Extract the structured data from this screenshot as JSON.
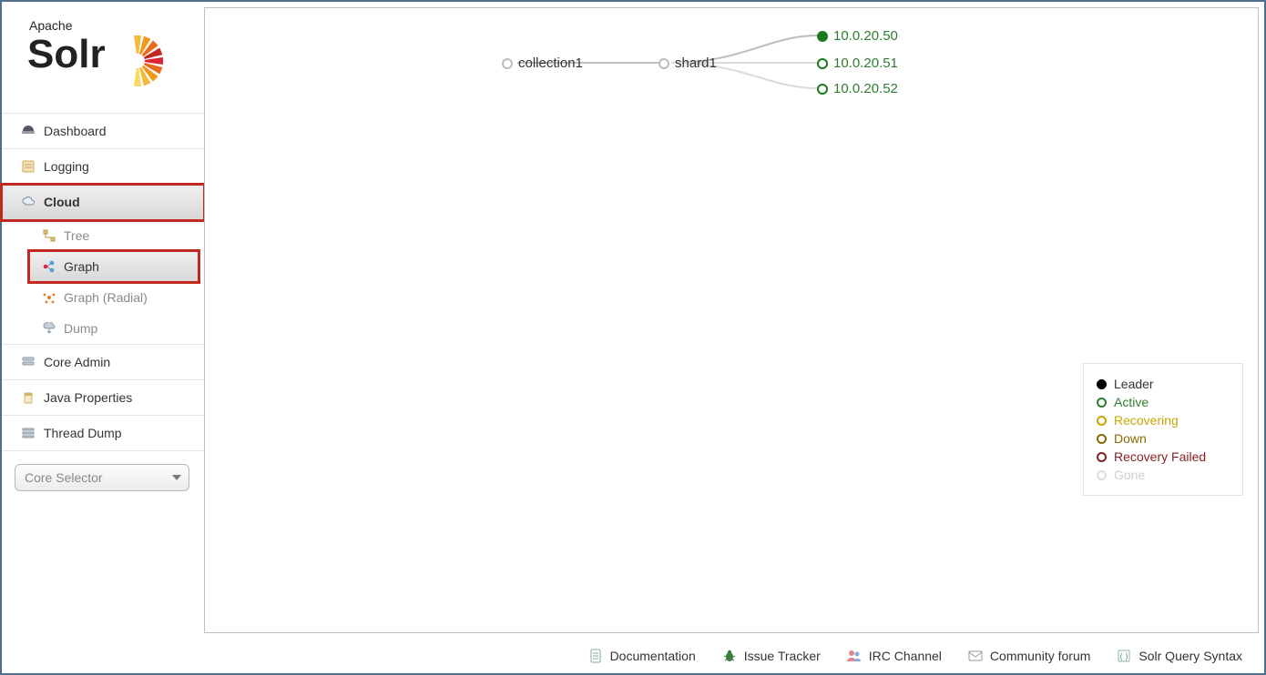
{
  "brand": {
    "apache": "Apache",
    "solr": "Solr"
  },
  "sidebar": {
    "items": [
      {
        "label": "Dashboard"
      },
      {
        "label": "Logging"
      },
      {
        "label": "Cloud"
      },
      {
        "label": "Core Admin"
      },
      {
        "label": "Java Properties"
      },
      {
        "label": "Thread Dump"
      }
    ],
    "cloud_sub": [
      {
        "label": "Tree"
      },
      {
        "label": "Graph"
      },
      {
        "label": "Graph (Radial)"
      },
      {
        "label": "Dump"
      }
    ],
    "core_selector_placeholder": "Core Selector"
  },
  "graph": {
    "collection": "collection1",
    "shard": "shard1",
    "replicas": [
      {
        "ip": "10.0.20.50",
        "role": "leader"
      },
      {
        "ip": "10.0.20.51",
        "role": "active"
      },
      {
        "ip": "10.0.20.52",
        "role": "active"
      }
    ]
  },
  "legend": {
    "leader": "Leader",
    "active": "Active",
    "recovering": "Recovering",
    "down": "Down",
    "recovery_failed": "Recovery Failed",
    "gone": "Gone"
  },
  "footer": {
    "documentation": "Documentation",
    "issue_tracker": "Issue Tracker",
    "irc_channel": "IRC Channel",
    "community_forum": "Community forum",
    "solr_query_syntax": "Solr Query Syntax"
  }
}
